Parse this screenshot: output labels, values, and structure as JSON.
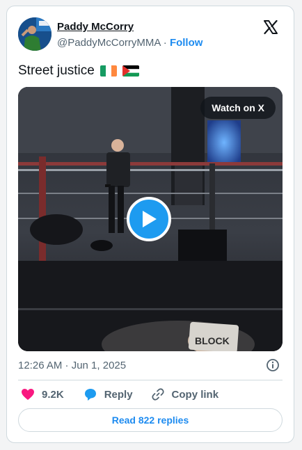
{
  "author": {
    "name": "Paddy McCorry",
    "handle": "@PaddyMcCorryMMA",
    "separator": "·",
    "follow_label": "Follow"
  },
  "tweet": {
    "text": "Street justice",
    "flags": [
      "ireland-flag",
      "palestine-flag"
    ]
  },
  "media": {
    "watch_label": "Watch on X",
    "sign_text": "BLOCK"
  },
  "meta": {
    "timestamp": "12:26 AM · Jun 1, 2025"
  },
  "actions": {
    "like_count": "9.2K",
    "reply_label": "Reply",
    "copy_link_label": "Copy link"
  },
  "read_replies_label": "Read 822 replies",
  "colors": {
    "accent": "#1d9bf0",
    "like": "#f91880",
    "text": "#0f1419",
    "muted": "#536471",
    "border": "#cfd9de"
  },
  "icons": [
    "x-logo-icon",
    "info-icon",
    "heart-icon",
    "reply-bubble-icon",
    "link-icon",
    "play-icon"
  ]
}
